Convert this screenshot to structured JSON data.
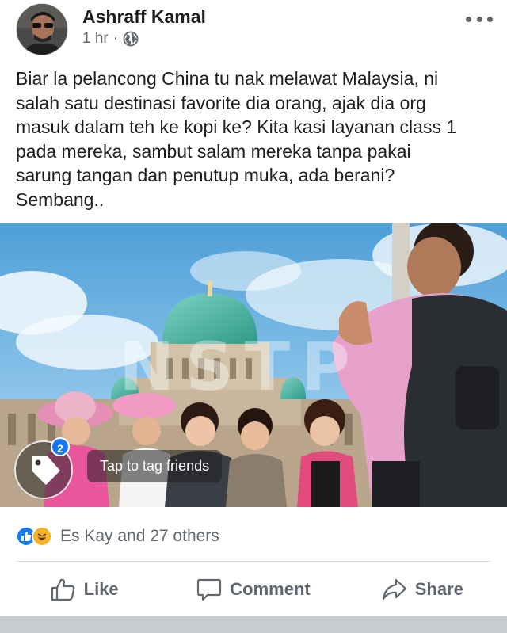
{
  "post": {
    "author": "Ashraff Kamal",
    "time": "1 hr",
    "separator": "·",
    "privacy_icon": "globe-icon",
    "more_icon": "more-options-icon",
    "text": "Biar la pelancong China tu nak melawat Malaysia, ni\nsalah satu destinasi favorite dia orang, ajak dia org\nmasuk dalam teh ke kopi ke? Kita kasi layanan class 1\npada mereka, sambut salam mereka tanpa pakai\nsarung tangan dan penutup muka, ada berani?\nSembang.."
  },
  "photo": {
    "watermark": "NSTP",
    "tag_count": "2",
    "tag_tooltip": "Tap to tag friends",
    "tag_icon": "tag-icon"
  },
  "reactions": {
    "icons": [
      "like-reaction-icon",
      "haha-reaction-icon"
    ],
    "summary": "Es Kay and 27 others"
  },
  "actions": {
    "like_label": "Like",
    "comment_label": "Comment",
    "share_label": "Share"
  },
  "colors": {
    "brand_blue": "#1877f2",
    "secondary_text": "#606770",
    "haha_yellow": "#f7b125"
  }
}
